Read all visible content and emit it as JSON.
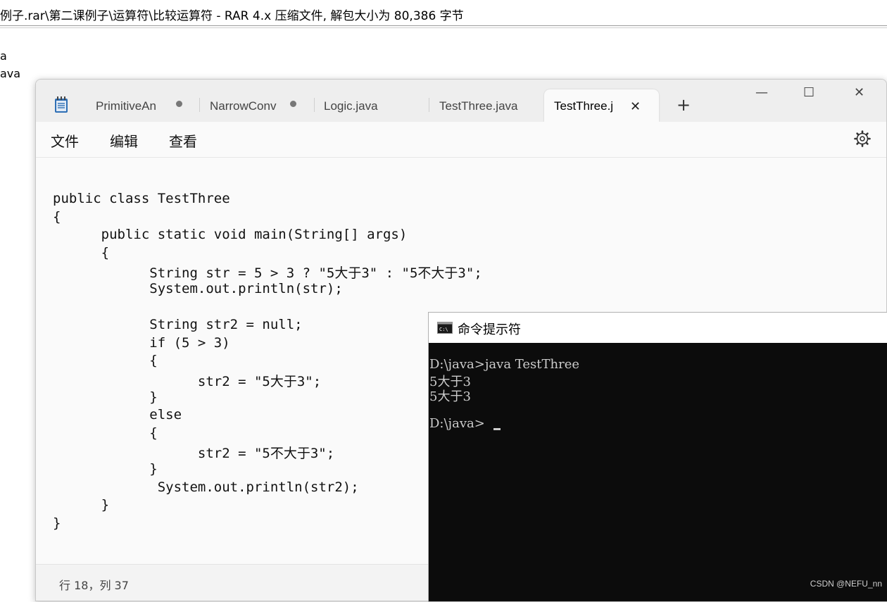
{
  "rar": {
    "path_title": "例子.rar\\第二课例子\\运算符\\比较运算符 - RAR 4.x 压缩文件, 解包大小为 80,386 字节",
    "file_rows": [
      "a",
      "ava"
    ]
  },
  "notepad": {
    "tabs": [
      {
        "label": "PrimitiveAn",
        "modified": true
      },
      {
        "label": "NarrowConv",
        "modified": true
      },
      {
        "label": "Logic.java",
        "modified": false
      },
      {
        "label": "TestThree.java",
        "modified": false
      },
      {
        "label": "TestThree.j",
        "active": true
      }
    ],
    "icons": {
      "app": "notepad-icon",
      "close_tab": "close-icon",
      "new_tab": "plus-icon",
      "minimize": "minimize-icon",
      "maximize": "maximize-icon",
      "close": "close-icon",
      "settings": "gear-icon"
    },
    "glyphs": {
      "close_tab": "✕",
      "new_tab": "+",
      "minimize": "—",
      "maximize": "☐",
      "close": "✕"
    },
    "menu": [
      "文件",
      "编辑",
      "查看"
    ],
    "code_lines": [
      "public class TestThree",
      "{",
      "      public static void main(String[] args)",
      "      {",
      "            String str = 5 > 3 ? \"5大于3\" : \"5不大于3\";",
      "            System.out.println(str);",
      "",
      "            String str2 = null;",
      "            if (5 > 3)",
      "            {",
      "                  str2 = \"5大于3\";",
      "            }",
      "            else",
      "            {",
      "                  str2 = \"5不大于3\";",
      "            }",
      "             System.out.println(str2);",
      "      }",
      "}"
    ],
    "status": {
      "position": "行 18，列 37"
    }
  },
  "cmd": {
    "title": "命令提示符",
    "icon": "console-icon",
    "lines": [
      "D:\\java>java TestThree",
      "5大于3",
      "5大于3",
      "",
      "D:\\java>"
    ],
    "watermark": "CSDN @NEFU_nn"
  },
  "colors": {
    "titlebar": "#eeeeee",
    "editor_bg": "#fafafa",
    "console_bg": "#0c0c0c",
    "console_fg": "#cccccc"
  }
}
